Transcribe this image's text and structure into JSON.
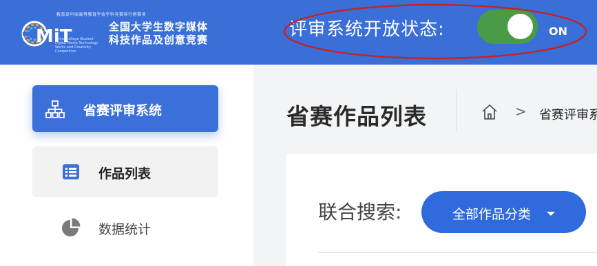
{
  "header": {
    "logo": {
      "top_text": "教育部中国高等教育学会学科竞赛排行榜赛项",
      "brand": "CMIT",
      "line1": "全国大学生数字媒体",
      "line2": "科技作品及创意竞赛",
      "sub_text": "China College Student Digital Media Technology Works and Creativity Competition"
    },
    "review_status_label": "评审系统开放状态:",
    "toggle_state": "ON",
    "colors": {
      "bar": "#3a6fd8",
      "toggle_on": "#4a9b47",
      "highlight": "#c0242b"
    }
  },
  "sidebar": {
    "items": [
      {
        "label": "省赛评审系统",
        "icon": "sitemap-icon"
      },
      {
        "label": "作品列表",
        "icon": "list-icon"
      },
      {
        "label": "数据统计",
        "icon": "pie-chart-icon"
      }
    ]
  },
  "main": {
    "title": "省赛作品列表",
    "breadcrumb": {
      "home_icon": "home-icon",
      "separator": ">",
      "current": "省赛评审系"
    },
    "search": {
      "label": "联合搜索:",
      "category_button": "全部作品分类"
    }
  }
}
